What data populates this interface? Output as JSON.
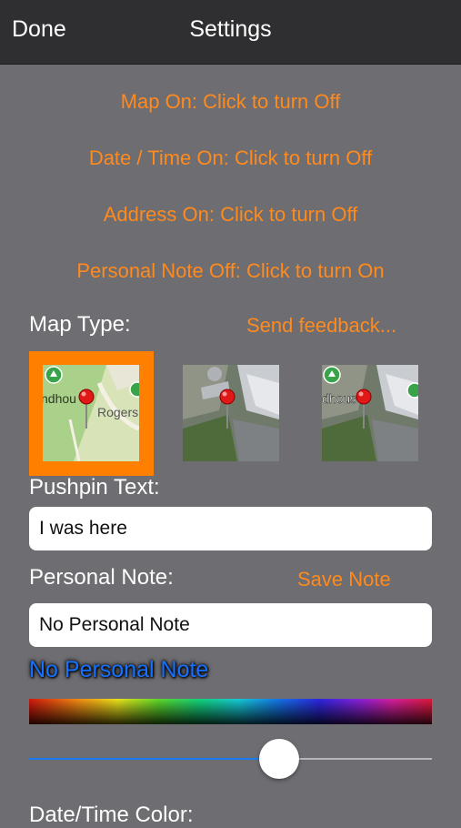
{
  "navbar": {
    "done_label": "Done",
    "title": "Settings"
  },
  "toggles": {
    "map": "Map On: Click to turn Off",
    "datetime": "Date / Time On: Click to turn Off",
    "address": "Address On: Click to turn Off",
    "personal_note": "Personal Note Off: Click to turn On"
  },
  "map_type": {
    "label": "Map Type:",
    "feedback_link": "Send feedback...",
    "options": [
      {
        "name": "standard",
        "selected": true,
        "map_text": "ndhou",
        "street_text": "Rogers"
      },
      {
        "name": "satellite",
        "selected": false
      },
      {
        "name": "hybrid",
        "selected": false,
        "map_text": "dhous"
      }
    ]
  },
  "pushpin": {
    "label": "Pushpin Text:",
    "value": "I was here"
  },
  "personal_note": {
    "label": "Personal Note:",
    "save_label": "Save Note",
    "value": "No Personal Note",
    "preview_text": "No Personal Note"
  },
  "color_slider": {
    "value_percent": 62
  },
  "datetime_color": {
    "label": "Date/Time Color:"
  },
  "colors": {
    "accent": "#ff8a1d",
    "navbar_bg": "#2f2f31",
    "page_bg": "#6d6d72",
    "selected_border": "#ff7f00",
    "preview_text_color": "#1671ff",
    "slider_fill": "#1b7cf0"
  }
}
